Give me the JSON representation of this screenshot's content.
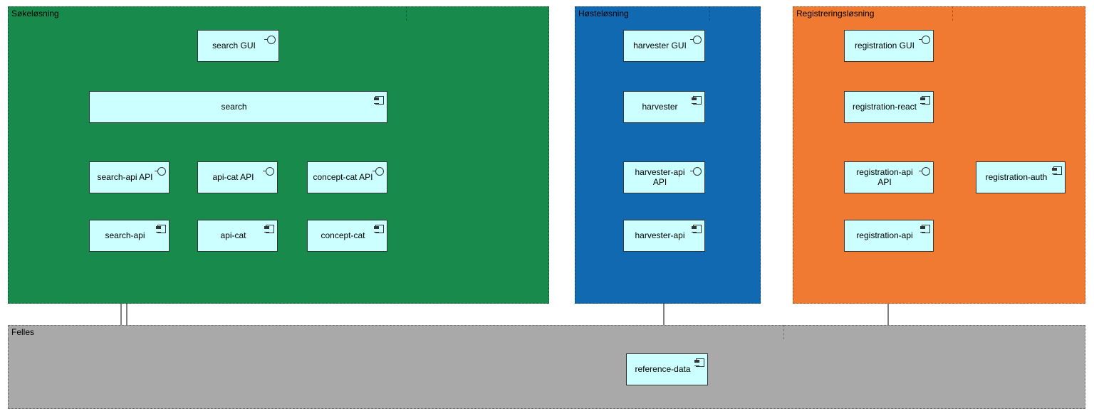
{
  "groups": {
    "search": {
      "title": "Søkeløsning"
    },
    "harvest": {
      "title": "Høsteløsning"
    },
    "register": {
      "title": "Registreringsløsning"
    },
    "common": {
      "title": "Felles"
    }
  },
  "nodes": {
    "searchGui": "search GUI",
    "search": "search",
    "searchApiApi": "search-api API",
    "apiCatApi": "api-cat API",
    "conceptCatApi": "concept-cat API",
    "searchApi": "search-api",
    "apiCat": "api-cat",
    "conceptCat": "concept-cat",
    "harvesterGui": "harvester GUI",
    "harvester": "harvester",
    "harvesterApiApi": "harvester-api API",
    "harvesterApi": "harvester-api",
    "registrationGui": "registration GUI",
    "registrationReact": "registration-react",
    "registrationApiApi": "registration-api API",
    "registrationAuth": "registration-auth",
    "registrationApi": "registration-api",
    "referenceData": "reference-data"
  },
  "chart_data": {
    "type": "diagram",
    "note": "ArchiMate-style application structure diagram",
    "groups": [
      {
        "id": "search",
        "label": "Søkeløsning",
        "color": "#178a4c"
      },
      {
        "id": "harvest",
        "label": "Høsteløsning",
        "color": "#1169b2"
      },
      {
        "id": "register",
        "label": "Registreringsløsning",
        "color": "#f07a32"
      },
      {
        "id": "common",
        "label": "Felles",
        "color": "#a9a9a9"
      }
    ],
    "elements": [
      {
        "id": "searchGui",
        "label": "search GUI",
        "type": "interface",
        "group": "search"
      },
      {
        "id": "search",
        "label": "search",
        "type": "component",
        "group": "search"
      },
      {
        "id": "searchApiApi",
        "label": "search-api API",
        "type": "interface",
        "group": "search"
      },
      {
        "id": "apiCatApi",
        "label": "api-cat API",
        "type": "interface",
        "group": "search"
      },
      {
        "id": "conceptCatApi",
        "label": "concept-cat API",
        "type": "interface",
        "group": "search"
      },
      {
        "id": "searchApi",
        "label": "search-api",
        "type": "component",
        "group": "search"
      },
      {
        "id": "apiCat",
        "label": "api-cat",
        "type": "component",
        "group": "search"
      },
      {
        "id": "conceptCat",
        "label": "concept-cat",
        "type": "component",
        "group": "search"
      },
      {
        "id": "harvesterGui",
        "label": "harvester GUI",
        "type": "interface",
        "group": "harvest"
      },
      {
        "id": "harvester",
        "label": "harvester",
        "type": "component",
        "group": "harvest"
      },
      {
        "id": "harvesterApiApi",
        "label": "harvester-api API",
        "type": "interface",
        "group": "harvest"
      },
      {
        "id": "harvesterApi",
        "label": "harvester-api",
        "type": "component",
        "group": "harvest"
      },
      {
        "id": "registrationGui",
        "label": "registration GUI",
        "type": "interface",
        "group": "register"
      },
      {
        "id": "registrationReact",
        "label": "registration-react",
        "type": "component",
        "group": "register"
      },
      {
        "id": "registrationApiApi",
        "label": "registration-api API",
        "type": "interface",
        "group": "register"
      },
      {
        "id": "registrationAuth",
        "label": "registration-auth",
        "type": "component",
        "group": "register"
      },
      {
        "id": "registrationApi",
        "label": "registration-api",
        "type": "component",
        "group": "register"
      },
      {
        "id": "referenceData",
        "label": "reference-data",
        "type": "component",
        "group": "common"
      }
    ],
    "relations": [
      {
        "from": "search",
        "to": "searchGui",
        "type": "realization"
      },
      {
        "from": "searchApi",
        "to": "searchApiApi",
        "type": "realization"
      },
      {
        "from": "apiCat",
        "to": "apiCatApi",
        "type": "realization"
      },
      {
        "from": "conceptCat",
        "to": "conceptCatApi",
        "type": "realization"
      },
      {
        "from": "harvester",
        "to": "harvesterGui",
        "type": "realization"
      },
      {
        "from": "harvesterApi",
        "to": "harvesterApiApi",
        "type": "realization"
      },
      {
        "from": "registrationReact",
        "to": "registrationGui",
        "type": "realization"
      },
      {
        "from": "registrationApi",
        "to": "registrationApiApi",
        "type": "realization"
      },
      {
        "from": "search",
        "to": "searchApiApi",
        "type": "uses"
      },
      {
        "from": "search",
        "to": "apiCatApi",
        "type": "uses"
      },
      {
        "from": "search",
        "to": "conceptCatApi",
        "type": "uses"
      },
      {
        "from": "harvester",
        "to": "harvesterApiApi",
        "type": "uses"
      },
      {
        "from": "registrationReact",
        "to": "registrationApiApi",
        "type": "uses"
      },
      {
        "from": "registrationAuth",
        "to": "registrationApiApi",
        "type": "uses"
      },
      {
        "from": "referenceData",
        "to": "searchApi",
        "type": "uses"
      },
      {
        "from": "referenceData",
        "to": "harvesterApi",
        "type": "uses"
      },
      {
        "from": "referenceData",
        "to": "registrationApi",
        "type": "uses"
      }
    ]
  }
}
